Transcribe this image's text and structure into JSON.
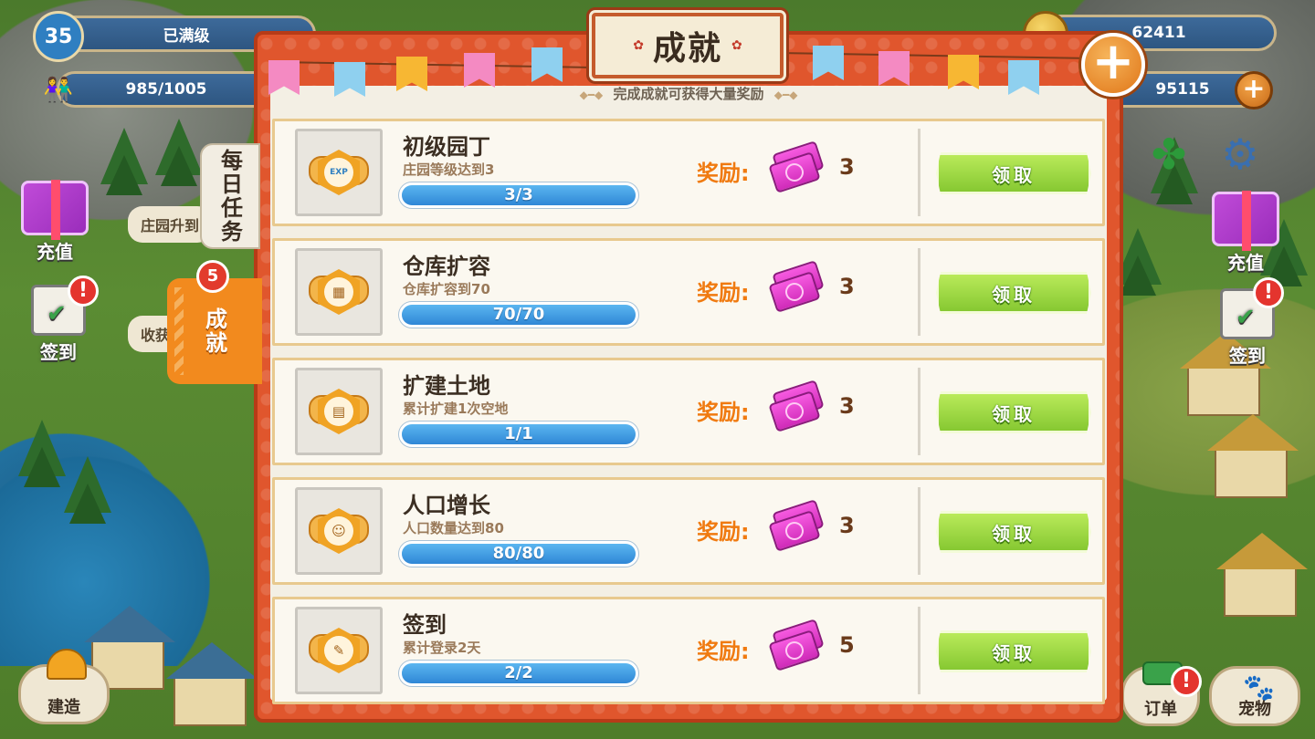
{
  "hud": {
    "level": "35",
    "level_status": "已满级",
    "population": "985/1005",
    "coins": "62411",
    "gems": "95115"
  },
  "left_buttons": {
    "recharge": "充值",
    "checkin": "签到",
    "build": "建造"
  },
  "right_buttons": {
    "recharge": "充值",
    "checkin": "签到",
    "orders": "订单",
    "pets": "宠物"
  },
  "tips": {
    "tip1": "庄园升到",
    "tip2": "收获"
  },
  "tabs": {
    "daily": "每日任务",
    "achievements": "成就",
    "achievements_badge": "5"
  },
  "panel": {
    "title": "成就",
    "subtitle": "完成成就可获得大量奖励",
    "reward_label": "奖励:",
    "claim_label": "领取"
  },
  "achievements": [
    {
      "name": "初级园丁",
      "desc": "庄园等级达到3",
      "progress": "3/3",
      "ratio": 1.0,
      "reward": "3",
      "icon": "exp-icon"
    },
    {
      "name": "仓库扩容",
      "desc": "仓库扩容到70",
      "progress": "70/70",
      "ratio": 1.0,
      "reward": "3",
      "icon": "warehouse-icon"
    },
    {
      "name": "扩建土地",
      "desc": "累计扩建1次空地",
      "progress": "1/1",
      "ratio": 1.0,
      "reward": "3",
      "icon": "land-icon"
    },
    {
      "name": "人口增长",
      "desc": "人口数量达到80",
      "progress": "80/80",
      "ratio": 1.0,
      "reward": "3",
      "icon": "population-icon"
    },
    {
      "name": "签到",
      "desc": "累计登录2天",
      "progress": "2/2",
      "ratio": 1.0,
      "reward": "5",
      "icon": "checkin-icon"
    }
  ],
  "colors": {
    "panel_red": "#e0562d",
    "claim_green": "#86c832",
    "progress_blue": "#2f87d6",
    "reward_orange": "#f07a10",
    "ticket_pink": "#cf2ab8"
  }
}
